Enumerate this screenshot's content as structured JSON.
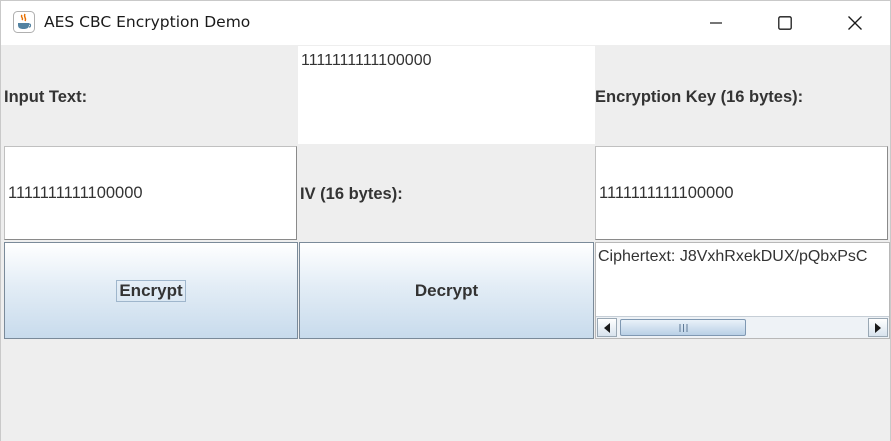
{
  "window": {
    "title": "AES CBC Encryption Demo",
    "icon": "java-cup-icon",
    "controls": [
      "minimize-icon",
      "maximize-icon",
      "close-icon"
    ]
  },
  "form": {
    "input_text_label": "Input Text:",
    "input_text_value": "1111111111100000",
    "encryption_key_label": "Encryption Key (16 bytes):",
    "encryption_key_value": "1111111111100000",
    "input_field_value": "1111111111100000",
    "iv_label": "IV (16 bytes):",
    "iv_value": "1111111111100000"
  },
  "buttons": {
    "encrypt_label": "Encrypt",
    "decrypt_label": "Decrypt"
  },
  "output": {
    "ciphertext": "Ciphertext: J8VxhRxekDUX/pQbxPsC"
  },
  "colors": {
    "window_bg": "#eeeeee",
    "button_gradient_top": "#ffffff",
    "button_gradient_bottom": "#c8dbec",
    "text": "#333333"
  }
}
